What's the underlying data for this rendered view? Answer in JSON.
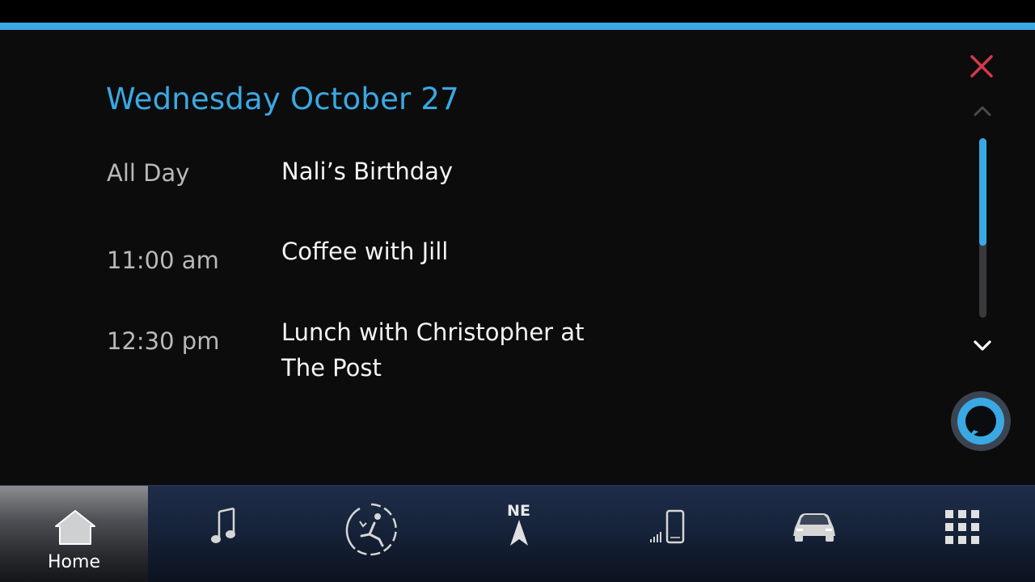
{
  "calendar": {
    "date_title": "Wednesday October 27",
    "events": [
      {
        "time": "All Day",
        "title": "Nali’s Birthday"
      },
      {
        "time": "11:00 am",
        "title": "Coffee with Jill"
      },
      {
        "time": "12:30 pm",
        "title": "Lunch with Christopher at\n The Post"
      }
    ]
  },
  "controls": {
    "close_icon": "close-icon",
    "scroll_up_icon": "chevron-up-icon",
    "scroll_down_icon": "chevron-down-icon",
    "assistant_icon": "alexa-icon"
  },
  "nav": {
    "home_label": "Home",
    "compass_heading": "NE",
    "items": [
      "home-icon",
      "music-icon",
      "seat-climate-icon",
      "navigation-icon",
      "phone-icon",
      "vehicle-icon",
      "apps-grid-icon"
    ]
  },
  "colors": {
    "accent": "#3aa9e3",
    "close": "#d23a4a",
    "background": "#0c0c0d"
  }
}
